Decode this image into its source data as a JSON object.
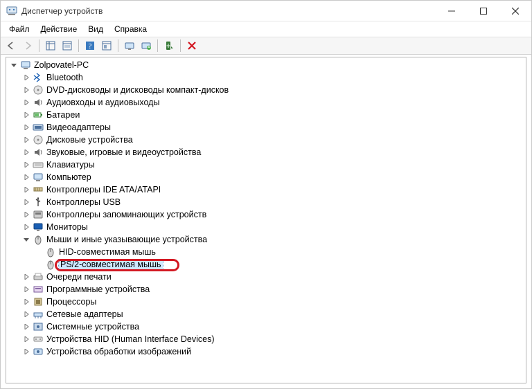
{
  "window": {
    "title": "Диспетчер устройств"
  },
  "menu": {
    "file": "Файл",
    "action": "Действие",
    "view": "Вид",
    "help": "Справка"
  },
  "tree": {
    "root": "Zolpovatel-PC",
    "items": [
      "Bluetooth",
      "DVD-дисководы и дисководы компакт-дисков",
      "Аудиовходы и аудиовыходы",
      "Батареи",
      "Видеоадаптеры",
      "Дисковые устройства",
      "Звуковые, игровые и видеоустройства",
      "Клавиатуры",
      "Компьютер",
      "Контроллеры IDE ATA/ATAPI",
      "Контроллеры USB",
      "Контроллеры запоминающих устройств",
      "Мониторы"
    ],
    "mice": {
      "label": "Мыши и иные указывающие устройства",
      "children": [
        "HID-совместимая мышь",
        "PS/2-совместимая мышь"
      ]
    },
    "items_after": [
      "Очереди печати",
      "Программные устройства",
      "Процессоры",
      "Сетевые адаптеры",
      "Системные устройства",
      "Устройства HID (Human Interface Devices)",
      "Устройства обработки изображений"
    ]
  }
}
